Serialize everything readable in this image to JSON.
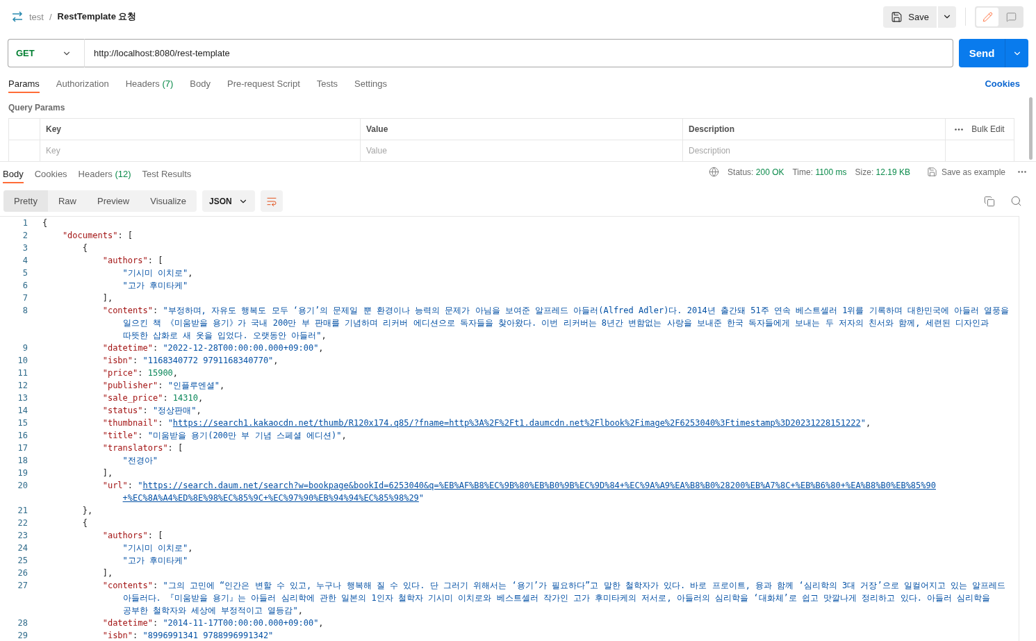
{
  "header": {
    "collection": "test",
    "separator": "/",
    "request": "RestTemplate 요청",
    "save": "Save",
    "edit_mode_selected": true
  },
  "request": {
    "method": "GET",
    "url": "http://localhost:8080/rest-template",
    "send": "Send"
  },
  "request_tabs": [
    {
      "label": "Params",
      "selected": true
    },
    {
      "label": "Authorization",
      "selected": false
    },
    {
      "label": "Headers",
      "count": "(7)",
      "selected": false
    },
    {
      "label": "Body",
      "selected": false
    },
    {
      "label": "Pre-request Script",
      "selected": false
    },
    {
      "label": "Tests",
      "selected": false
    },
    {
      "label": "Settings",
      "selected": false
    }
  ],
  "cookies_link": "Cookies",
  "query_params": {
    "title": "Query Params",
    "columns": [
      "Key",
      "Value",
      "Description"
    ],
    "bulk_edit": "Bulk Edit",
    "placeholders": [
      "Key",
      "Value",
      "Description"
    ]
  },
  "response_tabs": [
    {
      "label": "Body",
      "selected": true
    },
    {
      "label": "Cookies",
      "selected": false
    },
    {
      "label": "Headers",
      "count": "(12)",
      "selected": false
    },
    {
      "label": "Test Results",
      "selected": false
    }
  ],
  "response_meta": [
    {
      "label": "Status:",
      "value": "200 OK"
    },
    {
      "label": "Time:",
      "value": "1100 ms"
    },
    {
      "label": "Size:",
      "value": "12.19 KB"
    }
  ],
  "save_example": "Save as example",
  "view_modes": [
    {
      "label": "Pretty",
      "selected": true
    },
    {
      "label": "Raw",
      "selected": false
    },
    {
      "label": "Preview",
      "selected": false
    },
    {
      "label": "Visualize",
      "selected": false
    }
  ],
  "format": "JSON",
  "code": [
    {
      "number": "1",
      "tokens": [
        {
          "kind": "punct",
          "text": "{"
        }
      ],
      "children": [
        {
          "number": "2",
          "tokens": [
            {
              "kind": "key",
              "text": "\"documents\""
            },
            {
              "kind": "punct",
              "text": ": ["
            }
          ],
          "children": [
            {
              "number": "3",
              "tokens": [
                {
                  "kind": "punct",
                  "text": "{"
                }
              ],
              "children": [
                {
                  "number": "4",
                  "tokens": [
                    {
                      "kind": "key",
                      "text": "\"authors\""
                    },
                    {
                      "kind": "punct",
                      "text": ": ["
                    }
                  ],
                  "children": [
                    {
                      "number": "5",
                      "tokens": [
                        {
                          "kind": "str",
                          "text": "\"기시미 이치로\""
                        },
                        {
                          "kind": "punct",
                          "text": ","
                        }
                      ]
                    },
                    {
                      "number": "6",
                      "tokens": [
                        {
                          "kind": "str",
                          "text": "\"고가 후미타케\""
                        }
                      ]
                    }
                  ]
                },
                {
                  "number": "7",
                  "tokens": [
                    {
                      "kind": "punct",
                      "text": "],"
                    }
                  ]
                },
                {
                  "number": "8",
                  "tokens": [
                    {
                      "kind": "key",
                      "text": "\"contents\""
                    },
                    {
                      "kind": "punct",
                      "text": ": "
                    },
                    {
                      "kind": "str",
                      "text": "\"부정하며, 자유도 행복도 모두 ‘용기’의 문제일 뿐 환경이나 능력의 문제가 아님을 보여준 알프레드 아들러(Alfred Adler)다. 2014년 출간돼 51주 연속 베스트셀러 1위를 기록하며 대한민국에 아들러 열풍을"
                    }
                  ],
                  "continued": [
                    {
                      "tokens": [
                        {
                          "kind": "str",
                          "text": "일으킨 책 《미움받을 용기》가 국내 200만 부 판매를 기념하며 리커버 에디션으로 독자들을 찾아왔다. 이번 리커버는 8년간 변함없는 사랑을 보내준 한국 독자들에게 보내는 두 저자의 친서와 함께, 세련된 디자인과"
                        }
                      ]
                    },
                    {
                      "tokens": [
                        {
                          "kind": "str",
                          "text": "따뜻한 삽화로 새 옷을 입었다. 오랫동안 아들러\""
                        },
                        {
                          "kind": "punct",
                          "text": ","
                        }
                      ]
                    }
                  ]
                },
                {
                  "number": "9",
                  "tokens": [
                    {
                      "kind": "key",
                      "text": "\"datetime\""
                    },
                    {
                      "kind": "punct",
                      "text": ": "
                    },
                    {
                      "kind": "str",
                      "text": "\"2022-12-28T00:00:00.000+09:00\""
                    },
                    {
                      "kind": "punct",
                      "text": ","
                    }
                  ]
                },
                {
                  "number": "10",
                  "tokens": [
                    {
                      "kind": "key",
                      "text": "\"isbn\""
                    },
                    {
                      "kind": "punct",
                      "text": ": "
                    },
                    {
                      "kind": "str",
                      "text": "\"1168340772 9791168340770\""
                    },
                    {
                      "kind": "punct",
                      "text": ","
                    }
                  ]
                },
                {
                  "number": "11",
                  "tokens": [
                    {
                      "kind": "key",
                      "text": "\"price\""
                    },
                    {
                      "kind": "punct",
                      "text": ": "
                    },
                    {
                      "kind": "num",
                      "text": "15900"
                    },
                    {
                      "kind": "punct",
                      "text": ","
                    }
                  ]
                },
                {
                  "number": "12",
                  "tokens": [
                    {
                      "kind": "key",
                      "text": "\"publisher\""
                    },
                    {
                      "kind": "punct",
                      "text": ": "
                    },
                    {
                      "kind": "str",
                      "text": "\"인플루엔셜\""
                    },
                    {
                      "kind": "punct",
                      "text": ","
                    }
                  ]
                },
                {
                  "number": "13",
                  "tokens": [
                    {
                      "kind": "key",
                      "text": "\"sale_price\""
                    },
                    {
                      "kind": "punct",
                      "text": ": "
                    },
                    {
                      "kind": "num",
                      "text": "14310"
                    },
                    {
                      "kind": "punct",
                      "text": ","
                    }
                  ]
                },
                {
                  "number": "14",
                  "tokens": [
                    {
                      "kind": "key",
                      "text": "\"status\""
                    },
                    {
                      "kind": "punct",
                      "text": ": "
                    },
                    {
                      "kind": "str",
                      "text": "\"정상판매\""
                    },
                    {
                      "kind": "punct",
                      "text": ","
                    }
                  ]
                },
                {
                  "number": "15",
                  "tokens": [
                    {
                      "kind": "key",
                      "text": "\"thumbnail\""
                    },
                    {
                      "kind": "punct",
                      "text": ": "
                    },
                    {
                      "kind": "str",
                      "text": "\""
                    },
                    {
                      "kind": "link",
                      "text": "https://search1.kakaocdn.net/thumb/R120x174.q85/?fname=http%3A%2F%2Ft1.daumcdn.net%2Flbook%2Fimage%2F6253040%3Ftimestamp%3D20231228151222"
                    },
                    {
                      "kind": "str",
                      "text": "\""
                    },
                    {
                      "kind": "punct",
                      "text": ","
                    }
                  ]
                },
                {
                  "number": "16",
                  "tokens": [
                    {
                      "kind": "key",
                      "text": "\"title\""
                    },
                    {
                      "kind": "punct",
                      "text": ": "
                    },
                    {
                      "kind": "str",
                      "text": "\"미움받을 용기(200만 부 기념 스페셜 에디션)\""
                    },
                    {
                      "kind": "punct",
                      "text": ","
                    }
                  ]
                },
                {
                  "number": "17",
                  "tokens": [
                    {
                      "kind": "key",
                      "text": "\"translators\""
                    },
                    {
                      "kind": "punct",
                      "text": ": ["
                    }
                  ],
                  "children": [
                    {
                      "number": "18",
                      "tokens": [
                        {
                          "kind": "str",
                          "text": "\"전경아\""
                        }
                      ]
                    }
                  ]
                },
                {
                  "number": "19",
                  "tokens": [
                    {
                      "kind": "punct",
                      "text": "],"
                    }
                  ]
                },
                {
                  "number": "20",
                  "tokens": [
                    {
                      "kind": "key",
                      "text": "\"url\""
                    },
                    {
                      "kind": "punct",
                      "text": ": "
                    },
                    {
                      "kind": "str",
                      "text": "\""
                    },
                    {
                      "kind": "link",
                      "text": "https://search.daum.net/search?w=bookpage&bookId=6253040&q=%EB%AF%B8%EC%9B%80%EB%B0%9B%EC%9D%84+%EC%9A%A9%EA%B8%B0%28200%EB%A7%8C+%EB%B6%80+%EA%B8%B0%EB%85%90"
                    }
                  ],
                  "continued": [
                    {
                      "tokens": [
                        {
                          "kind": "link",
                          "text": "+%EC%8A%A4%ED%8E%98%EC%85%9C+%EC%97%90%EB%94%94%EC%85%98%29"
                        },
                        {
                          "kind": "str",
                          "text": "\""
                        }
                      ]
                    }
                  ]
                }
              ]
            },
            {
              "number": "21",
              "tokens": [
                {
                  "kind": "punct",
                  "text": "},"
                }
              ]
            },
            {
              "number": "22",
              "tokens": [
                {
                  "kind": "punct",
                  "text": "{"
                }
              ],
              "children": [
                {
                  "number": "23",
                  "tokens": [
                    {
                      "kind": "key",
                      "text": "\"authors\""
                    },
                    {
                      "kind": "punct",
                      "text": ": ["
                    }
                  ],
                  "children": [
                    {
                      "number": "24",
                      "tokens": [
                        {
                          "kind": "str",
                          "text": "\"기시미 이치로\""
                        },
                        {
                          "kind": "punct",
                          "text": ","
                        }
                      ]
                    },
                    {
                      "number": "25",
                      "tokens": [
                        {
                          "kind": "str",
                          "text": "\"고가 후미타케\""
                        }
                      ]
                    }
                  ]
                },
                {
                  "number": "26",
                  "tokens": [
                    {
                      "kind": "punct",
                      "text": "],"
                    }
                  ]
                },
                {
                  "number": "27",
                  "tokens": [
                    {
                      "kind": "key",
                      "text": "\"contents\""
                    },
                    {
                      "kind": "punct",
                      "text": ": "
                    },
                    {
                      "kind": "str",
                      "text": "\"그의 고민에 “인간은 변할 수 있고, 누구나 행복해 질 수 있다. 단 그러기 위해서는 ‘용기’가 필요하다”고 말한 철학자가 있다. 바로 프로이트, 융과 함께 ‘심리학의 3대 거장’으로 일컬어지고 있는 알프레드"
                    }
                  ],
                  "continued": [
                    {
                      "tokens": [
                        {
                          "kind": "str",
                          "text": "아들러다. 『미움받을 용기』는 아들러 심리학에 관한 일본의 1인자 철학자 기시미 이치로와 베스트셀러 작가인 고가 후미타케의 저서로, 아들러의 심리학을 ‘대화체’로 쉽고 맛깔나게 정리하고 있다. 아들러 심리학을"
                        }
                      ]
                    },
                    {
                      "tokens": [
                        {
                          "kind": "str",
                          "text": "공부한 철학자와 세상에 부정적이고 열등감\""
                        },
                        {
                          "kind": "punct",
                          "text": ","
                        }
                      ]
                    }
                  ]
                },
                {
                  "number": "28",
                  "tokens": [
                    {
                      "kind": "key",
                      "text": "\"datetime\""
                    },
                    {
                      "kind": "punct",
                      "text": ": "
                    },
                    {
                      "kind": "str",
                      "text": "\"2014-11-17T00:00:00.000+09:00\""
                    },
                    {
                      "kind": "punct",
                      "text": ","
                    }
                  ]
                },
                {
                  "number": "29",
                  "tokens": [
                    {
                      "kind": "key",
                      "text": "\"isbn\""
                    },
                    {
                      "kind": "punct",
                      "text": ": "
                    },
                    {
                      "kind": "str",
                      "text": "\"8996991341 9788996991342\""
                    }
                  ]
                }
              ]
            }
          ]
        }
      ]
    }
  ]
}
